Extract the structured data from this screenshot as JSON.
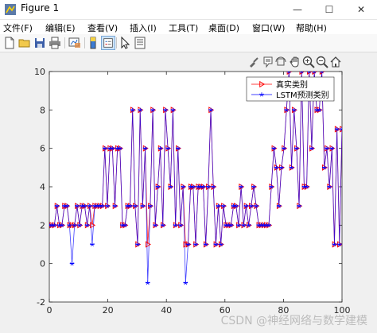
{
  "window": {
    "title": "Figure 1",
    "minimize": "—",
    "maximize": "☐",
    "close": "✕"
  },
  "menu": [
    "文件(F)",
    "编辑(E)",
    "查看(V)",
    "插入(I)",
    "工具(T)",
    "桌面(D)",
    "窗口(W)",
    "帮助(H)"
  ],
  "toolbar": {
    "icons": [
      "new-figure-icon",
      "open-file-icon",
      "save-icon",
      "print-icon",
      "link-plot-icon",
      "insert-colorbar-icon",
      "insert-legend-icon",
      "edit-plot-icon",
      "property-inspector-icon"
    ]
  },
  "axes_toolbar": {
    "icons": [
      "brush-icon",
      "data-tips-icon",
      "rotate-icon",
      "pan-icon",
      "zoom-in-icon",
      "zoom-out-icon",
      "home-icon"
    ]
  },
  "watermark": "CSDN @神经网络与数学建模",
  "colors": {
    "true_series": "#ff0000",
    "pred_series": "#0000ff",
    "axes_bg": "#ffffff"
  },
  "chart_data": {
    "type": "line",
    "xlim": [
      0,
      100
    ],
    "ylim": [
      -2,
      10
    ],
    "xticks": [
      "0",
      "20",
      "40",
      "60",
      "80",
      "100"
    ],
    "yticks": [
      "-2",
      "0",
      "2",
      "4",
      "6",
      "8",
      "10"
    ],
    "legend_position": "top-right",
    "series": [
      {
        "name": "真实类别",
        "marker": "triangle-right",
        "color": "#ff0000",
        "values": [
          2,
          2,
          2,
          3,
          2,
          2,
          3,
          3,
          2,
          2,
          2,
          3,
          2,
          3,
          3,
          2,
          3,
          2,
          3,
          3,
          3,
          3,
          6,
          3,
          6,
          6,
          3,
          6,
          6,
          2,
          2,
          3,
          3,
          8,
          3,
          1,
          8,
          3,
          6,
          1,
          3,
          8,
          2,
          4,
          6,
          2,
          8,
          6,
          4,
          8,
          2,
          6,
          2,
          4,
          1,
          1,
          4,
          4,
          1,
          4,
          4,
          4,
          1,
          4,
          8,
          4,
          1,
          3,
          1,
          3,
          2,
          2,
          2,
          3,
          3,
          2,
          4,
          2,
          3,
          2,
          3,
          4,
          3,
          2,
          2,
          2,
          2,
          2,
          4,
          6,
          5,
          3,
          5,
          6,
          8,
          10,
          5,
          8,
          6,
          3,
          10,
          4,
          4,
          10,
          6,
          10,
          8,
          8,
          10,
          5,
          6,
          4,
          6,
          1,
          7,
          1,
          7
        ]
      },
      {
        "name": "LSTM预测类别",
        "marker": "star",
        "color": "#0000ff",
        "values": [
          2,
          2,
          2,
          3,
          2,
          2,
          3,
          3,
          2,
          0,
          2,
          3,
          2,
          3,
          3,
          2,
          3,
          1,
          3,
          3,
          3,
          3,
          6,
          3,
          6,
          6,
          3,
          6,
          6,
          2,
          2,
          3,
          3,
          8,
          3,
          1,
          8,
          3,
          6,
          -1,
          3,
          8,
          2,
          4,
          6,
          2,
          8,
          6,
          4,
          8,
          2,
          6,
          2,
          4,
          -1,
          1,
          4,
          4,
          1,
          4,
          4,
          4,
          1,
          4,
          8,
          4,
          1,
          3,
          1,
          3,
          2,
          2,
          2,
          3,
          3,
          2,
          4,
          2,
          3,
          2,
          3,
          4,
          3,
          2,
          2,
          2,
          2,
          2,
          4,
          6,
          5,
          3,
          5,
          6,
          8,
          10,
          5,
          8,
          6,
          3,
          10,
          4,
          4,
          10,
          6,
          10,
          8,
          8,
          10,
          5,
          6,
          4,
          6,
          1,
          7,
          1,
          7
        ]
      }
    ]
  }
}
